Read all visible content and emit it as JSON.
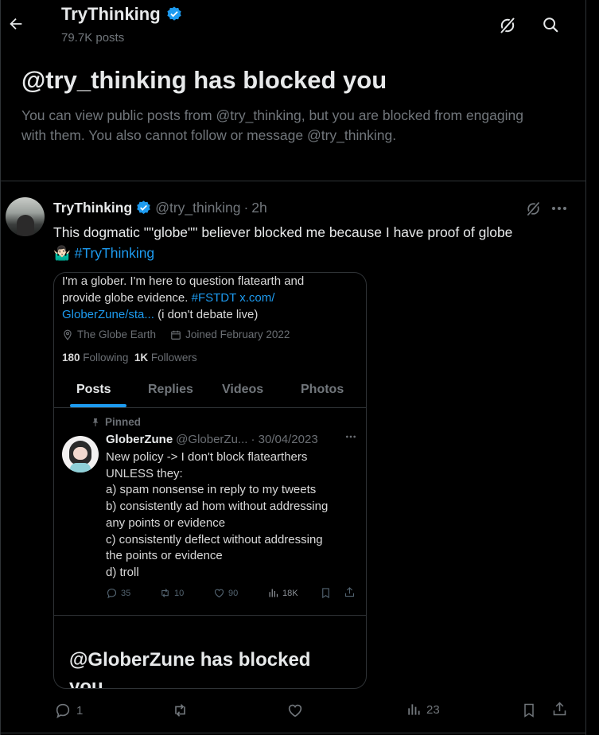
{
  "header": {
    "title": "TryThinking",
    "subtitle": "79.7K posts"
  },
  "blocked_notice": {
    "title": "@try_thinking has blocked you",
    "body": "You can view public posts from @try_thinking, but you are blocked from engaging with them. You also cannot follow or message @try_thinking."
  },
  "post": {
    "display_name": "TryThinking",
    "handle": "@try_thinking",
    "separator": "·",
    "time": "2h",
    "text": "This dogmatic \"\"globe\"\" believer blocked me because I have proof of globe",
    "emoji": "🤷🏻‍♂️",
    "hashtag": "#TryThinking",
    "actions": {
      "replies": "1",
      "reposts": "",
      "likes": "",
      "views": "23"
    }
  },
  "embedded_image": {
    "bio_line1": "I'm a glober. I'm here to question flatearth and",
    "bio_line2_text": "provide globe evidence. ",
    "bio_line2_link": "#FSTDT x.com/",
    "bio_line3_link": "GloberZune/sta...",
    "bio_line3_text": " (i don't debate live)",
    "location": "The Globe Earth",
    "joined": "Joined February 2022",
    "following_count": "180",
    "following_label": "Following",
    "followers_count": "1K",
    "followers_label": "Followers",
    "tabs": [
      "Posts",
      "Replies",
      "Videos",
      "Photos"
    ],
    "pinned_label": "Pinned",
    "inner_post": {
      "name": "GloberZune",
      "handle": "@GloberZu...",
      "date": "· 30/04/2023",
      "lines": [
        "New policy -> I don't block flatearthers",
        "UNLESS they:",
        "a) spam nonsense in reply to my tweets",
        "b) consistently ad hom without addressing",
        "any points or evidence",
        "c) consistently deflect without addressing",
        "the points or evidence",
        "d) troll"
      ],
      "replies": "35",
      "reposts": "10",
      "likes": "90",
      "views": "18K"
    },
    "blocked_banner": "@GloberZune has blocked you"
  },
  "colors": {
    "background": "#000000",
    "text": "#e7e9ea",
    "muted": "#71767b",
    "accent": "#1d9bf0",
    "border": "#2f3336"
  },
  "icons": [
    "back-arrow-icon",
    "grok-icon",
    "search-icon",
    "verified-badge-icon",
    "more-icon",
    "reply-icon",
    "repost-icon",
    "like-icon",
    "views-icon",
    "bookmark-icon",
    "share-icon",
    "location-icon",
    "calendar-icon",
    "pin-icon"
  ]
}
